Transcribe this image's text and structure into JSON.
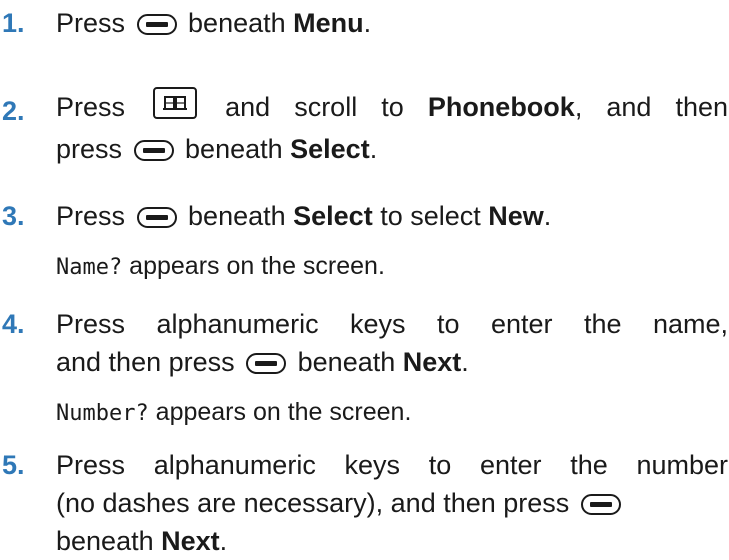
{
  "steps": [
    {
      "number": "1.",
      "segments": [
        {
          "t": "Press "
        },
        {
          "icon": "softkey"
        },
        {
          "t": " beneath "
        },
        {
          "b": "Menu"
        },
        {
          "t": "."
        }
      ]
    },
    {
      "number": "2.",
      "line1": {
        "pre": "Press ",
        "mid": " and scroll to ",
        "bold": "Phonebook",
        "post": ", and then"
      },
      "line2": {
        "pre": "press ",
        "mid": " beneath ",
        "bold": "Select",
        "post": "."
      }
    },
    {
      "number": "3.",
      "line1": {
        "pre": "Press ",
        "mid": " beneath ",
        "bold1": "Select",
        "mid2": " to select ",
        "bold2": "New",
        "post": "."
      },
      "sub": {
        "mono": "Name?",
        "text": " appears on the screen."
      }
    },
    {
      "number": "4.",
      "line1": "Press alphanumeric keys to enter the name,",
      "line2": {
        "pre": "and then press ",
        "mid": " beneath ",
        "bold": "Next",
        "post": "."
      },
      "sub": {
        "mono": "Number?",
        "text": " appears on the screen."
      }
    },
    {
      "number": "5.",
      "line1": "Press alphanumeric keys to enter the number",
      "line2": "(no dashes are necessary), and then press",
      "line3": {
        "pre": "beneath ",
        "bold": "Next",
        "post": "."
      }
    }
  ],
  "icons": {
    "softkey": "softkey-icon",
    "phonebook": "phonebook-key-icon"
  },
  "colors": {
    "step_number": "#2f78b7",
    "text": "#1a1a1a"
  }
}
